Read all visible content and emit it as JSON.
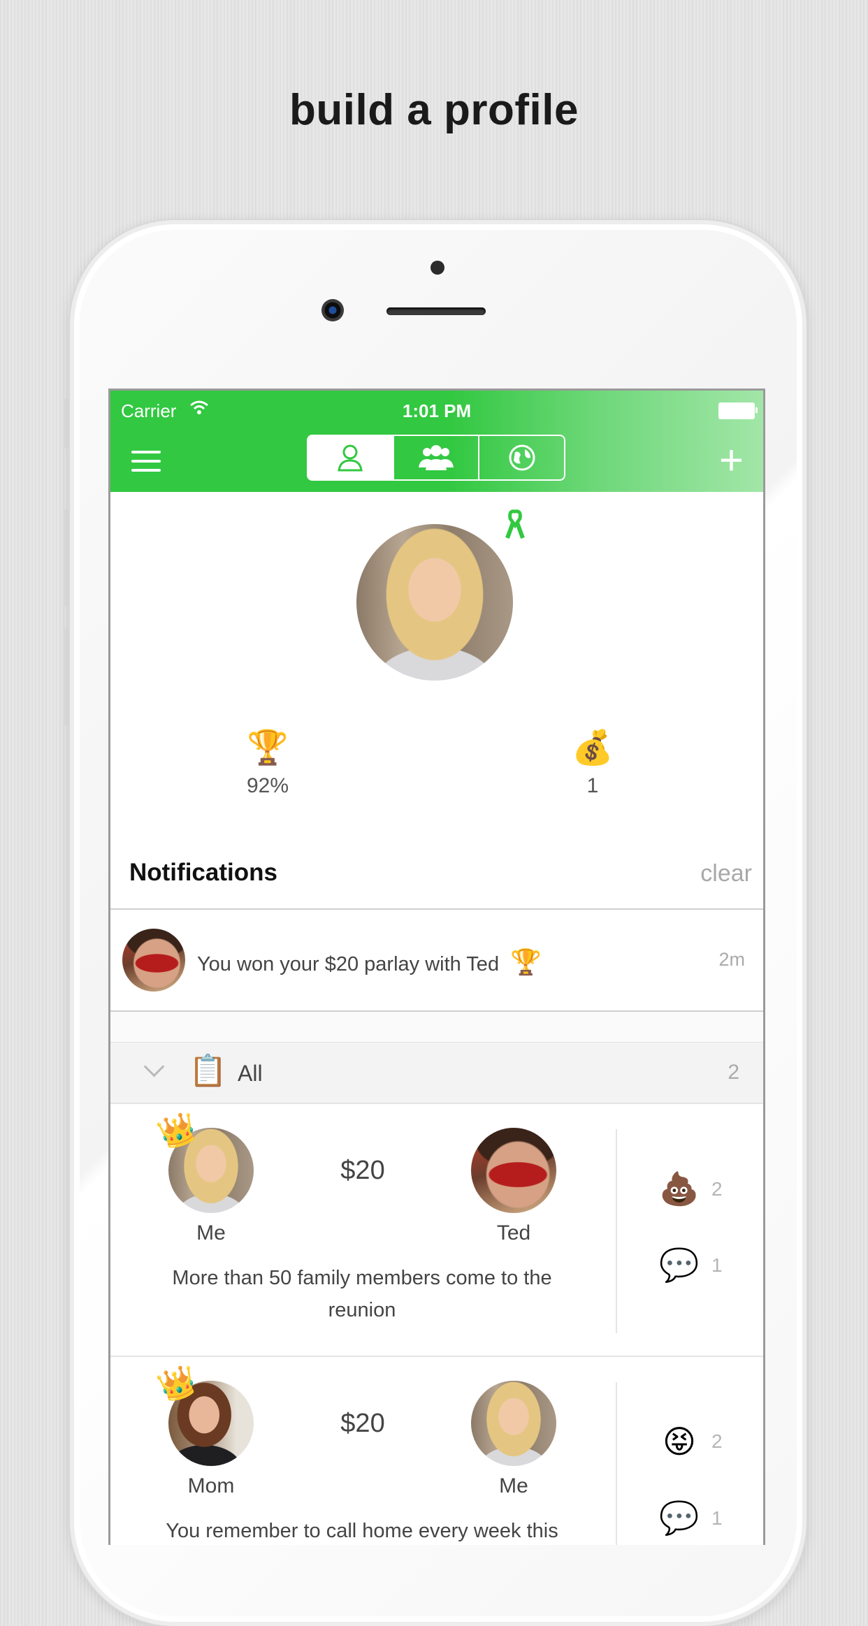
{
  "headline": "build a profile",
  "status_bar": {
    "carrier": "Carrier",
    "time": "1:01 PM"
  },
  "nav": {
    "tabs": [
      {
        "icon": "person-icon"
      },
      {
        "icon": "group-icon"
      },
      {
        "icon": "globe-icon"
      }
    ],
    "active_tab": 0,
    "accent": "#32c841"
  },
  "profile": {
    "win_rate": "92%",
    "money_count": "1"
  },
  "notifications": {
    "title": "Notifications",
    "clear_label": "clear",
    "items": [
      {
        "text": "You won your $20 parlay with Ted",
        "emoji": "🏆",
        "time": "2m"
      }
    ]
  },
  "section": {
    "label": "All",
    "count": "2",
    "icon": "clipboard-icon"
  },
  "bets": [
    {
      "left_name": "Me",
      "right_name": "Ted",
      "amount": "$20",
      "description": "More than 50 family members come to the reunion",
      "reactions": [
        {
          "emoji": "💩",
          "count": "2"
        },
        {
          "emoji": "💬",
          "count": "1"
        }
      ]
    },
    {
      "left_name": "Mom",
      "right_name": "Me",
      "amount": "$20",
      "description": "You remember to call home every week this",
      "reactions": [
        {
          "emoji": "😝",
          "count": "2"
        },
        {
          "emoji": "💬",
          "count": "1"
        }
      ]
    }
  ]
}
